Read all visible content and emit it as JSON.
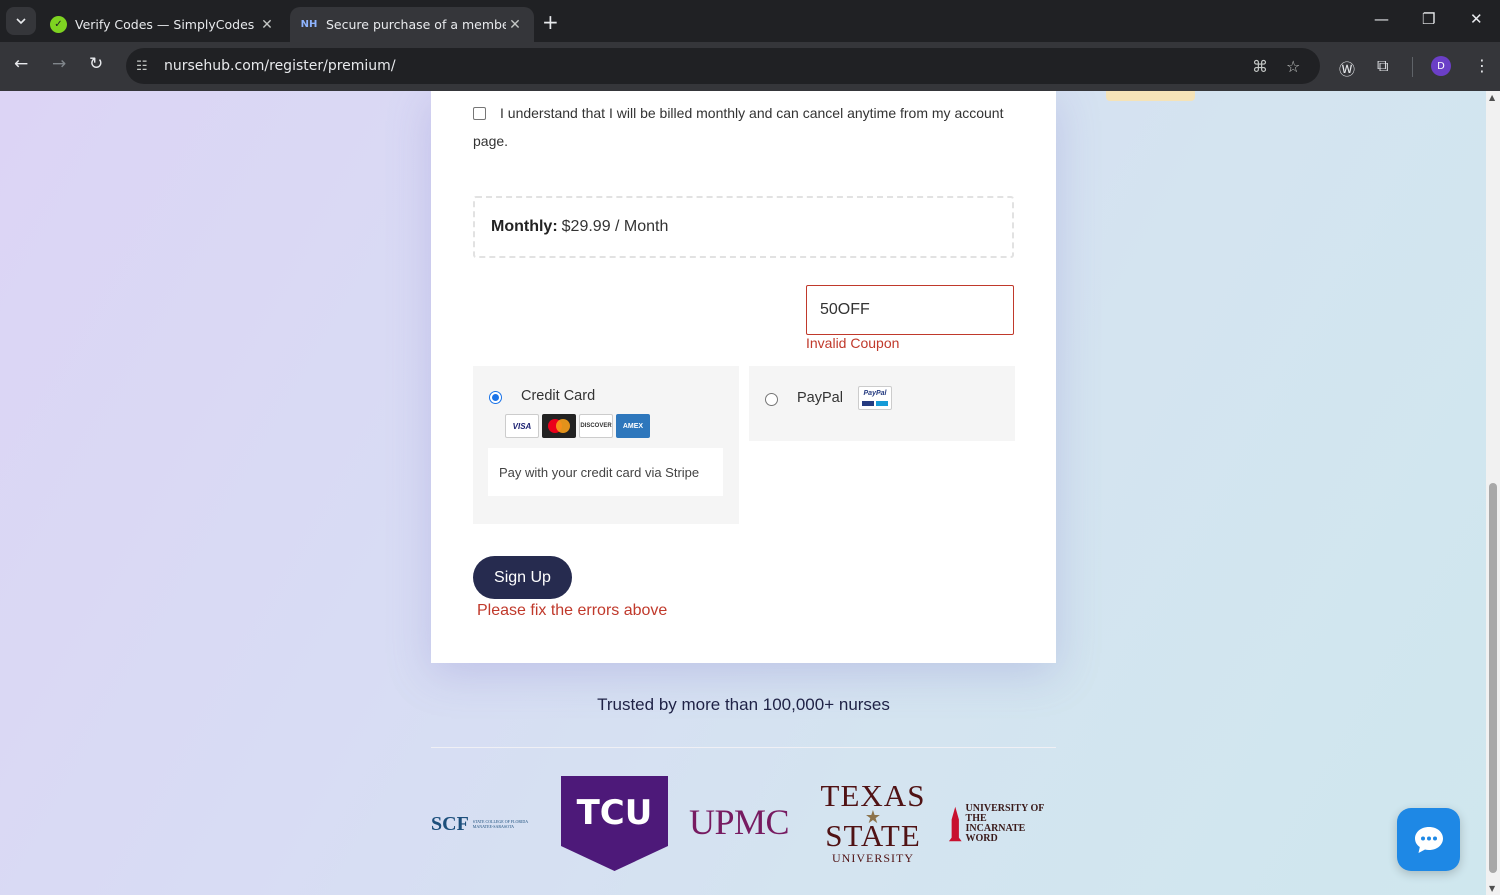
{
  "browser": {
    "tabs": [
      {
        "title": "Verify Codes — SimplyCodes",
        "favicon": "check-icon"
      },
      {
        "title": "Secure purchase of a members",
        "favicon_text": "NH"
      }
    ],
    "url": {
      "host": "nursehub.com",
      "path": "/register/premium/"
    },
    "profile_initial": "D"
  },
  "form": {
    "billing_agreement": "I understand that I will be billed monthly and can cancel anytime from my account page.",
    "price_label": "Monthly:",
    "price_value": "$29.99 / Month",
    "coupon_value": "50OFF",
    "coupon_error": "Invalid Coupon",
    "payment_methods": {
      "credit_card": {
        "label": "Credit Card",
        "selected": true,
        "brands": [
          "VISA",
          "MasterCard",
          "DISCOVER",
          "AMEX"
        ],
        "description": "Pay with your credit card via Stripe"
      },
      "paypal": {
        "label": "PayPal",
        "selected": false,
        "logo_text": "PayPal"
      }
    },
    "submit_label": "Sign Up",
    "form_error": "Please fix the errors above"
  },
  "trust": {
    "heading": "Trusted by more than 100,000+ nurses",
    "logos": {
      "scf_mark": "SCF",
      "scf_text": "STATE COLLEGE OF FLORIDA MANATEE-SARASOTA",
      "tcu": "TCU",
      "upmc": "UPMC",
      "texas_state_l1": "TEXAS",
      "texas_state_l2": "STATE",
      "texas_state_l3": "UNIVERSITY",
      "uiw_l1": "UNIVERSITY OF THE",
      "uiw_l2": "INCARNATE WORD"
    }
  },
  "colors": {
    "accent_button": "#262b4f",
    "error": "#c0392b",
    "chat_button": "#1e88e5"
  }
}
